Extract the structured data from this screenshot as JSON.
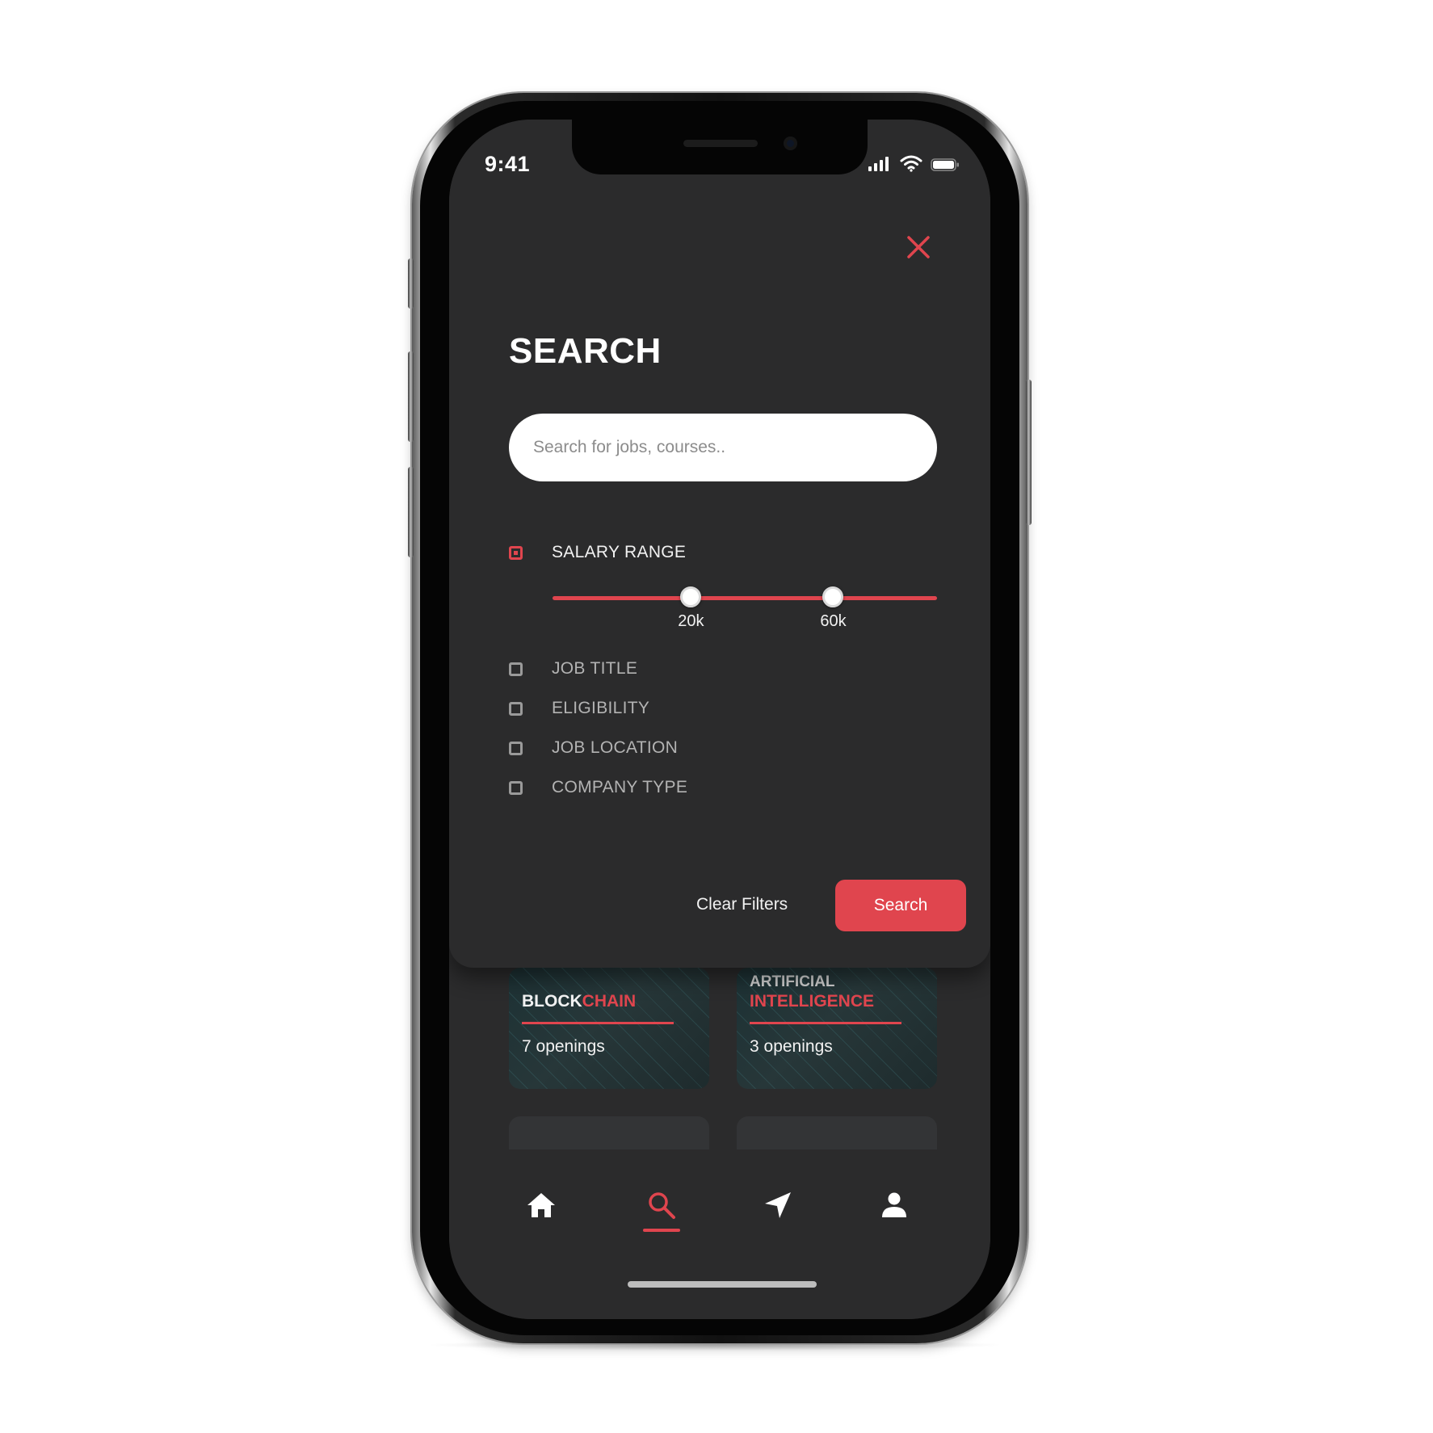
{
  "status_bar": {
    "time": "9:41"
  },
  "modal": {
    "title": "SEARCH",
    "search_placeholder": "Search for jobs, courses..",
    "salary": {
      "label": "SALARY RANGE",
      "checked": true,
      "min_label": "20k",
      "max_label": "60k",
      "min_fraction": 0.36,
      "max_fraction": 0.73
    },
    "filters": [
      {
        "label": "JOB TITLE",
        "checked": false
      },
      {
        "label": "ELIGIBILITY",
        "checked": false
      },
      {
        "label": "JOB LOCATION",
        "checked": false
      },
      {
        "label": "COMPANY TYPE",
        "checked": false
      }
    ],
    "clear_label": "Clear Filters",
    "search_label": "Search"
  },
  "background_cards": [
    {
      "title_white": "BLOCK",
      "title_red": "CHAIN",
      "openings": "7 openings"
    },
    {
      "title_top": "ARTIFICIAL",
      "title_red": "INTELLIGENCE",
      "openings": "3 openings"
    }
  ],
  "bottom_nav": {
    "items": [
      "home-icon",
      "search-icon",
      "navigation-arrow-icon",
      "profile-icon"
    ],
    "active": "search-icon"
  },
  "colors": {
    "accent": "#e0454e",
    "background": "#2b2b2c",
    "text_primary": "#f2f2f2",
    "text_muted": "#b3b3b3"
  }
}
